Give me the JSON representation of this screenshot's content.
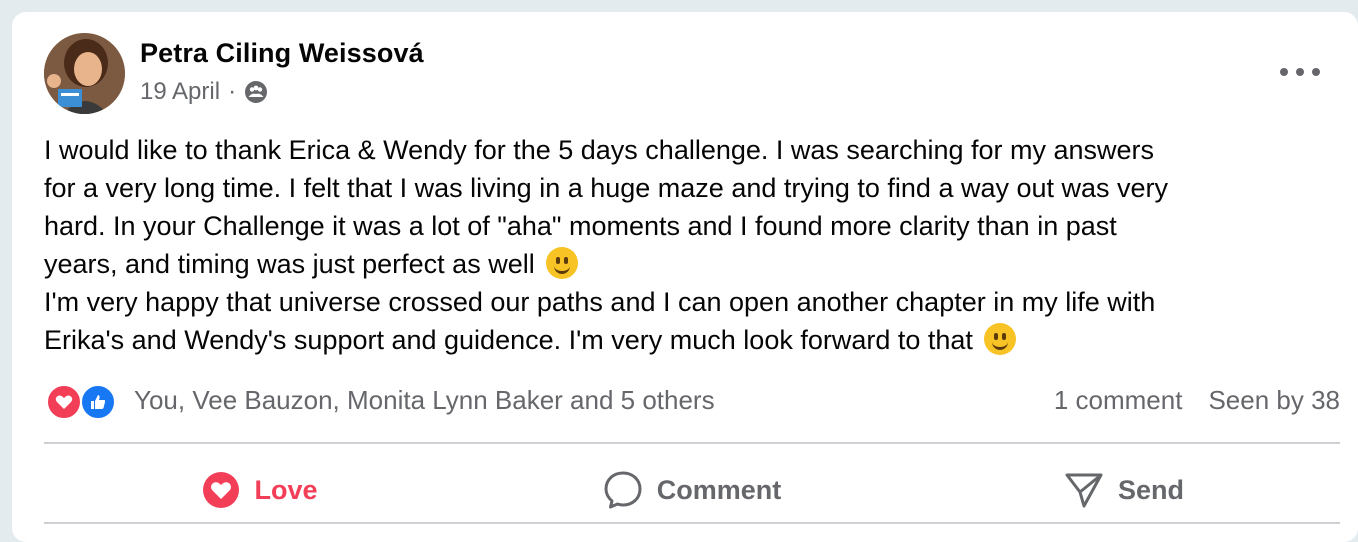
{
  "post": {
    "author": "Petra Ciling Weissová",
    "date": "19 April",
    "separator": "·",
    "privacy_icon": "group-icon",
    "more_icon": "more-icon",
    "text": {
      "line1": "I would like to thank Erica & Wendy for the 5 days challenge. I was searching for my answers",
      "line2": "for a very long time. I felt that I was living in a huge maze and trying to find a way out was very",
      "line3": "hard. In your Challenge it was a lot of \"aha\" moments and I found more clarity than in past",
      "line4": "years, and timing was just perfect as well",
      "line5": "I'm very happy that universe crossed our paths and I can open another chapter in my life with",
      "line6": "Erika's and Wendy's support and guidence. I'm very much look forward to that"
    }
  },
  "reactions": {
    "icons": [
      "love-reaction-icon",
      "like-reaction-icon"
    ],
    "names": "You, Vee Bauzon, Monita Lynn Baker and 5 others",
    "comments": "1 comment",
    "seen": "Seen by 38"
  },
  "actions": {
    "love": "Love",
    "comment": "Comment",
    "send": "Send"
  },
  "colors": {
    "love": "#f33e58",
    "like": "#1877f2",
    "secondary_text": "#65676b",
    "background": "#e3ebee"
  }
}
